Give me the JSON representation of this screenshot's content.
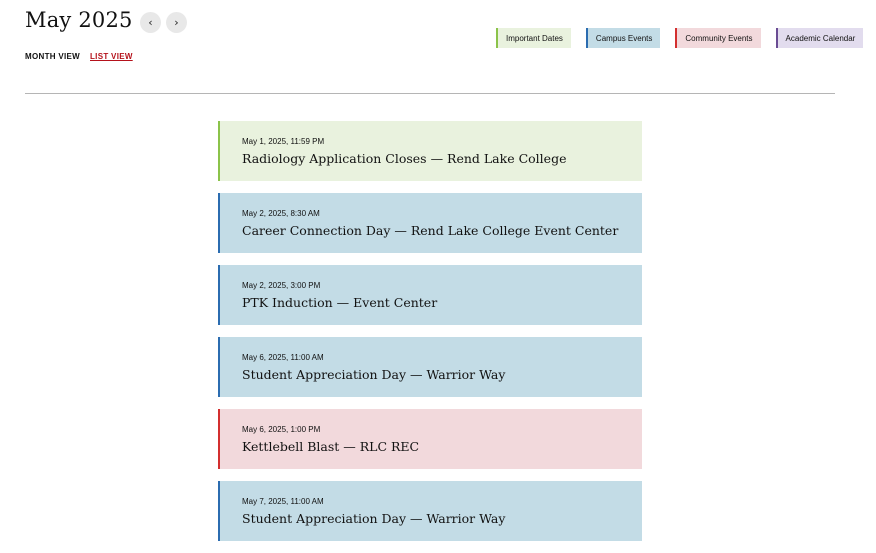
{
  "header": {
    "month_title": "May 2025",
    "prev_icon": "‹",
    "next_icon": "›"
  },
  "views": {
    "month_label": "MONTH VIEW",
    "list_label": "LIST VIEW",
    "active": "list"
  },
  "legend": [
    {
      "label": "Important Dates",
      "bg": "#e9f2de",
      "border": "#8bc34a"
    },
    {
      "label": "Campus Events",
      "bg": "#c3dce6",
      "border": "#2b6cb0"
    },
    {
      "label": "Community Events",
      "bg": "#f2d9dc",
      "border": "#d32f2f"
    },
    {
      "label": "Academic Calendar",
      "bg": "#e2dcee",
      "border": "#6a4c93"
    }
  ],
  "events": [
    {
      "time": "May 1, 2025, 11:59 PM",
      "title": "Radiology Application Closes — Rend Lake College",
      "category": 0
    },
    {
      "time": "May 2, 2025, 8:30 AM",
      "title": "Career Connection Day — Rend Lake College Event Center",
      "category": 1
    },
    {
      "time": "May 2, 2025, 3:00 PM",
      "title": "PTK Induction — Event Center",
      "category": 1
    },
    {
      "time": "May 6, 2025, 11:00 AM",
      "title": "Student Appreciation Day — Warrior Way",
      "category": 1
    },
    {
      "time": "May 6, 2025, 1:00 PM",
      "title": "Kettlebell Blast — RLC REC",
      "category": 2
    },
    {
      "time": "May 7, 2025, 11:00 AM",
      "title": "Student Appreciation Day — Warrior Way",
      "category": 1
    }
  ]
}
